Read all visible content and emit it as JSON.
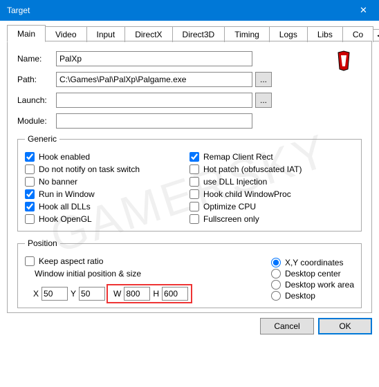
{
  "window": {
    "title": "Target"
  },
  "tabs": {
    "items": [
      "Main",
      "Video",
      "Input",
      "DirectX",
      "Direct3D",
      "Timing",
      "Logs",
      "Libs",
      "Co"
    ],
    "active": 0,
    "left_arrow": "◂",
    "right_arrow": "▸"
  },
  "fields": {
    "name_label": "Name:",
    "name_value": "PalXp",
    "path_label": "Path:",
    "path_value": "C:\\Games\\Pal\\PalXp\\Palgame.exe",
    "launch_label": "Launch:",
    "launch_value": "",
    "module_label": "Module:",
    "module_value": "",
    "browse": "..."
  },
  "generic": {
    "legend": "Generic",
    "left": [
      {
        "label": "Hook enabled",
        "checked": true
      },
      {
        "label": "Do not notify on task switch",
        "checked": false
      },
      {
        "label": "No banner",
        "checked": false
      },
      {
        "label": "Run in Window",
        "checked": true
      },
      {
        "label": "Hook all DLLs",
        "checked": true
      },
      {
        "label": "Hook OpenGL",
        "checked": false
      }
    ],
    "right": [
      {
        "label": "Remap Client Rect",
        "checked": true
      },
      {
        "label": "Hot patch (obfuscated IAT)",
        "checked": false
      },
      {
        "label": "use DLL Injection",
        "checked": false
      },
      {
        "label": "Hook child WindowProc",
        "checked": false
      },
      {
        "label": "Optimize CPU",
        "checked": false
      },
      {
        "label": "Fullscreen only",
        "checked": false
      }
    ]
  },
  "position": {
    "legend": "Position",
    "keep_aspect": {
      "label": "Keep aspect ratio",
      "checked": false
    },
    "size_label": "Window initial position & size",
    "x_label": "X",
    "x_value": "50",
    "y_label": "Y",
    "y_value": "50",
    "w_label": "W",
    "w_value": "800",
    "h_label": "H",
    "h_value": "600",
    "radios": [
      {
        "label": "X,Y coordinates",
        "checked": true
      },
      {
        "label": "Desktop center",
        "checked": false
      },
      {
        "label": "Desktop work area",
        "checked": false
      },
      {
        "label": "Desktop",
        "checked": false
      }
    ]
  },
  "buttons": {
    "cancel": "Cancel",
    "ok": "OK"
  },
  "watermark": "GAMERSKY"
}
